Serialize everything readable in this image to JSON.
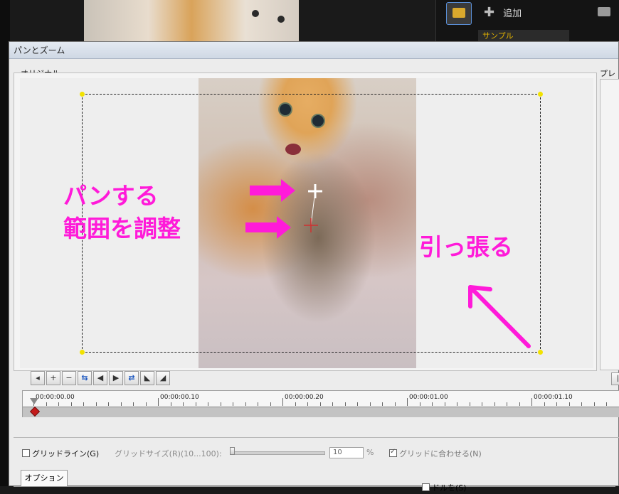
{
  "background_app": {
    "add_label": "追加",
    "sample_tab": "サンプル",
    "icons": [
      "media-library-icon",
      "plus-icon",
      "folder-icon"
    ]
  },
  "dialog": {
    "title": "パンとズーム",
    "original_label": "オリジナル",
    "preview_label": "プレビ",
    "annotations": {
      "pan_line1": "パンする",
      "pan_line2": "範囲を調整",
      "drag": "引っ張る"
    },
    "toolbar": [
      {
        "icon": "goto-start-icon",
        "glyph": "◂"
      },
      {
        "icon": "add-keyframe-icon",
        "glyph": "+"
      },
      {
        "icon": "remove-keyframe-icon",
        "glyph": "−"
      },
      {
        "icon": "reverse-keyframes-icon",
        "glyph": "⇆"
      },
      {
        "icon": "prev-keyframe-icon",
        "glyph": "◀"
      },
      {
        "icon": "next-keyframe-icon",
        "glyph": "▶"
      },
      {
        "icon": "swap-keyframe-icon",
        "glyph": "⇄"
      },
      {
        "icon": "goto-prev-icon",
        "glyph": "◣"
      },
      {
        "icon": "goto-next-icon",
        "glyph": "◢"
      }
    ],
    "timeline": {
      "labels": [
        "00:00:00.00",
        "00:00:00.10",
        "00:00:00.20",
        "00:00:01.00",
        "00:00:01.10"
      ]
    },
    "grid": {
      "gridline_label": "グリッドライン(G)",
      "gridline_checked": false,
      "size_label": "グリッドサイズ(R)(10...100):",
      "size_value": "10",
      "size_unit": "%",
      "snap_label": "グリッドに合わせる(N)",
      "snap_checked": true
    },
    "options_tab": "オプション",
    "bottom_partial": "ドルを(S)"
  },
  "colors": {
    "annotation": "#ff1ad9",
    "handle": "#f2e200",
    "keyframe": "#c41a1a"
  }
}
